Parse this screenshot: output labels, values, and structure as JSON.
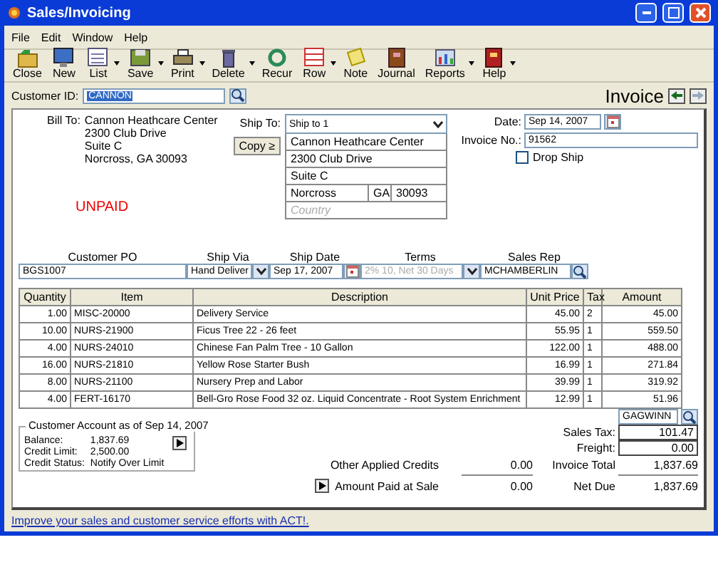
{
  "window": {
    "title": "Sales/Invoicing"
  },
  "menu": [
    "File",
    "Edit",
    "Window",
    "Help"
  ],
  "toolbar": [
    {
      "label": "Close",
      "dropdown": false
    },
    {
      "label": "New",
      "dropdown": false
    },
    {
      "label": "List",
      "dropdown": true
    },
    {
      "label": "Save",
      "dropdown": true
    },
    {
      "label": "Print",
      "dropdown": true
    },
    {
      "label": "Delete",
      "dropdown": true
    },
    {
      "label": "Recur",
      "dropdown": false
    },
    {
      "label": "Row",
      "dropdown": true
    },
    {
      "label": "Note",
      "dropdown": false
    },
    {
      "label": "Journal",
      "dropdown": false
    },
    {
      "label": "Reports",
      "dropdown": true
    },
    {
      "label": "Help",
      "dropdown": true
    }
  ],
  "customer_id": {
    "label": "Customer ID:",
    "value": "CANNON"
  },
  "doc_title": "Invoice",
  "bill_to": {
    "label": "Bill To:",
    "lines": [
      "Cannon Heathcare Center",
      "2300 Club Drive",
      "Suite C",
      "Norcross, GA 30093"
    ]
  },
  "status": "UNPAID",
  "ship_to": {
    "label": "Ship To:",
    "selection": "Ship to 1",
    "copy_button": "Copy ≥",
    "name": "Cannon Heathcare Center",
    "street": "2300 Club Drive",
    "street2": "Suite C",
    "city": "Norcross",
    "state": "GA",
    "zip": "30093",
    "country_placeholder": "Country"
  },
  "date": {
    "label": "Date:",
    "value": "Sep 14, 2007"
  },
  "invoice_no": {
    "label": "Invoice No.:",
    "value": "91562"
  },
  "drop_ship": {
    "label": "Drop Ship",
    "checked": false
  },
  "order_fields": [
    {
      "label": "Customer PO",
      "value": "BGS1007",
      "kind": "text",
      "disabled": false
    },
    {
      "label": "Ship Via",
      "value": "Hand Deliver",
      "kind": "dropdown",
      "disabled": false
    },
    {
      "label": "Ship Date",
      "value": "Sep 17, 2007",
      "kind": "date",
      "disabled": false
    },
    {
      "label": "Terms",
      "value": "2% 10, Net 30 Days",
      "kind": "dropdown",
      "disabled": true
    },
    {
      "label": "Sales Rep",
      "value": "MCHAMBERLIN",
      "kind": "lookup",
      "disabled": false
    }
  ],
  "table": {
    "columns": [
      "Quantity",
      "Item",
      "Description",
      "Unit Price",
      "Tax",
      "Amount"
    ],
    "rows": [
      [
        "1.00",
        "MISC-20000",
        "Delivery Service",
        "45.00",
        "2",
        "45.00"
      ],
      [
        "10.00",
        "NURS-21900",
        "Ficus Tree 22 - 26 feet",
        "55.95",
        "1",
        "559.50"
      ],
      [
        "4.00",
        "NURS-24010",
        "Chinese Fan Palm Tree - 10 Gallon",
        "122.00",
        "1",
        "488.00"
      ],
      [
        "16.00",
        "NURS-21810",
        "Yellow Rose Starter Bush",
        "16.99",
        "1",
        "271.84"
      ],
      [
        "8.00",
        "NURS-21100",
        "Nursery Prep and Labor",
        "39.99",
        "1",
        "319.92"
      ],
      [
        "4.00",
        "FERT-16170",
        "Bell-Gro Rose Food 32 oz. Liquid Concentrate - Root System Enrichment",
        "12.99",
        "1",
        "51.96"
      ]
    ]
  },
  "tax_code": "GAGWINN",
  "sales_tax": {
    "label": "Sales Tax:",
    "value": "101.47"
  },
  "freight": {
    "label": "Freight:",
    "value": "0.00"
  },
  "account": {
    "title": "Customer Account as of Sep 14, 2007",
    "rows": [
      {
        "label": "Balance:",
        "value": "1,837.69"
      },
      {
        "label": "Credit Limit:",
        "value": "2,500.00"
      },
      {
        "label": "Credit Status:",
        "value": "Notify Over Limit"
      }
    ]
  },
  "totals": [
    {
      "label": "Other Applied Credits",
      "value": "0.00",
      "total_label": "Invoice Total",
      "total_value": "1,837.69",
      "button": false
    },
    {
      "label": "Amount Paid at Sale",
      "value": "0.00",
      "total_label": "Net Due",
      "total_value": "1,837.69",
      "button": true
    }
  ],
  "link": "Improve your sales and customer service efforts with ACT!."
}
